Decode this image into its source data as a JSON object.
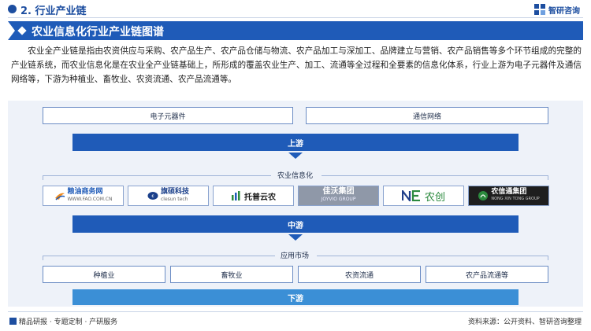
{
  "header": {
    "section_title": "2. 行业产业链",
    "logo_text": "智研咨询"
  },
  "banner": {
    "title": "农业信息化行业产业链图谱"
  },
  "intro": {
    "text": "农业全产业链是指由农资供应与采购、农产品生产、农产品仓储与物流、农产品加工与深加工、品牌建立与营销、农产品销售等多个环节组成的完整的产业链系统，而农业信息化是在农业全产业链基础上，所形成的覆盖农业生产、加工、流通等全过程和全要素的信息化体系，行业上游为电子元器件及通信网络等，下游为种植业、畜牧业、农资流通、农产品流通等。"
  },
  "diagram": {
    "upstream": {
      "items": [
        "电子元器件",
        "通信网络"
      ],
      "label": "上游"
    },
    "midstream": {
      "section_label": "农业信息化",
      "companies": [
        {
          "name": "粮油商务网",
          "sub": "WWW.FAO.COM.CN",
          "color": "#1f5bb8"
        },
        {
          "name": "旗硕科技",
          "sub": "clesun tech",
          "color": "#1a3f8a"
        },
        {
          "name": "托普云农",
          "sub": "",
          "color": "#1a1a1a"
        },
        {
          "name": "佳沃集团",
          "sub": "JOYVIO GROUP",
          "color": "#ffffff"
        },
        {
          "name": "农创",
          "sub": "",
          "color": "#2b8a3e"
        },
        {
          "name": "农信通集团",
          "sub": "NONG XIN TONG GROUP",
          "color": "#ffffff"
        }
      ],
      "label": "中游"
    },
    "downstream": {
      "section_label": "应用市场",
      "items": [
        "种植业",
        "畜牧业",
        "农资流通",
        "农产品流通等"
      ],
      "label": "下游"
    }
  },
  "footer": {
    "left": "精品研报 · 专题定制 · 产研服务",
    "right": "资料来源：公开资料、智研咨询整理"
  },
  "colors": {
    "primary": "#1f5bb8",
    "downstream_bar": "#3b8fd6",
    "diagram_bg": "#eef2f9"
  }
}
